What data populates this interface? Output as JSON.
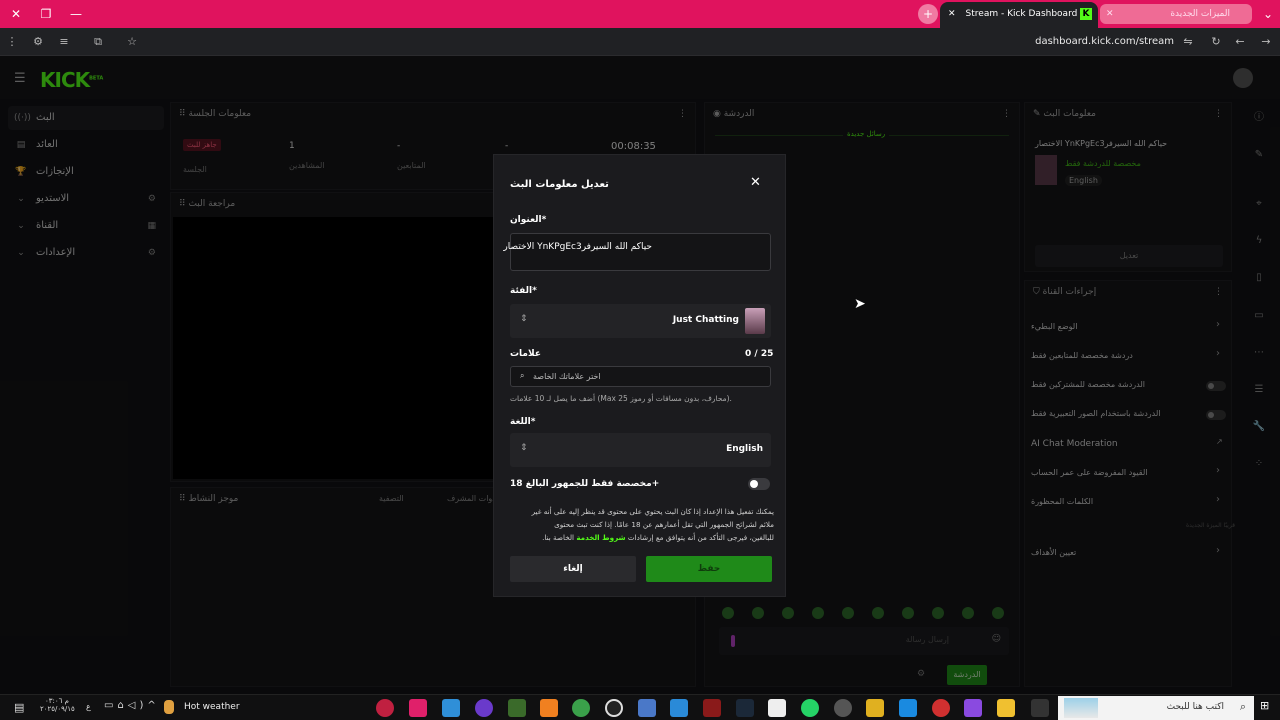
{
  "browser": {
    "tab_active_title": "Stream - Kick Dashboard",
    "tab_other_title": "الميزات الجديدة",
    "url": "dashboard.kick.com/stream"
  },
  "app": {
    "logo": "KICK",
    "logo_badge": "BETA",
    "sidebar": {
      "items": [
        {
          "label": "البث",
          "icon": "broadcast-icon"
        },
        {
          "label": "العائد",
          "icon": "revenue-icon"
        },
        {
          "label": "الإنجازات",
          "icon": "trophy-icon"
        },
        {
          "label": "الاستديو",
          "icon": "studio-icon"
        },
        {
          "label": "القناة",
          "icon": "channel-icon"
        },
        {
          "label": "الإعدادات",
          "icon": "settings-icon"
        }
      ]
    },
    "session_panel": {
      "title": "معلومات الجلسة",
      "badge": "جاهز للبث",
      "stats": [
        {
          "label": "الجلسة",
          "value": ""
        },
        {
          "label": "المشاهدين",
          "value": "1"
        },
        {
          "label": "المتابعين",
          "value": "-"
        },
        {
          "label": "",
          "value": "-"
        },
        {
          "label": "",
          "value": "00:08:35"
        }
      ]
    },
    "review_panel": {
      "title": "مراجعة البث"
    },
    "activity_panel": {
      "title": "موجز النشاط"
    },
    "filter_label": "التصفية",
    "mod_label": "أدوات المشرف",
    "chat_panel": {
      "title": "الدردشة",
      "new_messages": "رسائل جديدة",
      "input_placeholder": "إرسال رسالة",
      "send_button": "الدردشة"
    },
    "stream_info_panel": {
      "title": "معلومات البث",
      "stream_title": "الاختصار YnKPgEc3حياكم الله السيرفر",
      "category_line": "مخصصة للدردشة فقط",
      "language": "English",
      "edit_button": "تعديل"
    },
    "channel_actions": {
      "title": "إجراءات القناة",
      "items": [
        {
          "label": "الوضع البطيء",
          "control": "chevron"
        },
        {
          "label": "دردشة مخصصة للمتابعين فقط",
          "control": "chevron"
        },
        {
          "label": "الدردشة مخصصة للمشتركين فقط",
          "control": "toggle"
        },
        {
          "label": "الدردشة باستخدام الصور التعبيرية فقط",
          "control": "toggle"
        },
        {
          "label": "AI Chat Moderation",
          "control": "external"
        },
        {
          "label": "القيود المفروضة على عمر الحساب",
          "control": "chevron"
        },
        {
          "label": "الكلمات المحظورة",
          "control": "chevron"
        },
        {
          "label": "تعيين الأهداف",
          "control": "chevron"
        }
      ],
      "small_note": "قريبًا الميزة الجديدة"
    }
  },
  "modal": {
    "title": "تعديل معلومات البث",
    "close_icon": "close-icon",
    "title_label": "العنوان*",
    "title_value": "الاختصار YnKPgEc3حياكم الله السيرفر",
    "category_label": "الفئة*",
    "category_value": "Just Chatting",
    "tags_label": "علامات",
    "tags_count": "0 / 25",
    "tags_placeholder": "اختر علاماتك الخاصة",
    "tags_hint": "أضف ما يصل لـ 10 علامات (Max 25 محارف، بدون مسافات أو رموز).",
    "language_label": "اللغة*",
    "language_value": "English",
    "adult_label": "مخصصة فقط للجمهور البالغ 18+",
    "adult_toggle": false,
    "adult_desc_1": "يمكنك تفعيل هذا الإعداد إذا كان البث يحتوي على محتوى قد ينظر إليه على أنه غير",
    "adult_desc_2": "ملائم لشرائح الجمهور التي تقل أعمارهم عن 18 عامًا. إذا كنت تبث محتوى",
    "adult_desc_3": "للبالغين، فيرجى التأكد من أنه يتوافق مع إرشادات",
    "terms_link": "شروط الخدمة",
    "adult_desc_4": "الخاصة بنا.",
    "cancel_button": "إلغاء",
    "save_button": "حفظ"
  },
  "taskbar": {
    "weather_text": "Hot weather",
    "search_placeholder": "اكتب هنا للبحث",
    "time": "م ٠٣:٠٦",
    "date": "٢٠٢٥/٠٩/١٥",
    "lang_indicator": "ع"
  },
  "colors": {
    "accent_green": "#53fc18",
    "save_green": "#1f8a19",
    "browser_pink": "#e0135e"
  }
}
